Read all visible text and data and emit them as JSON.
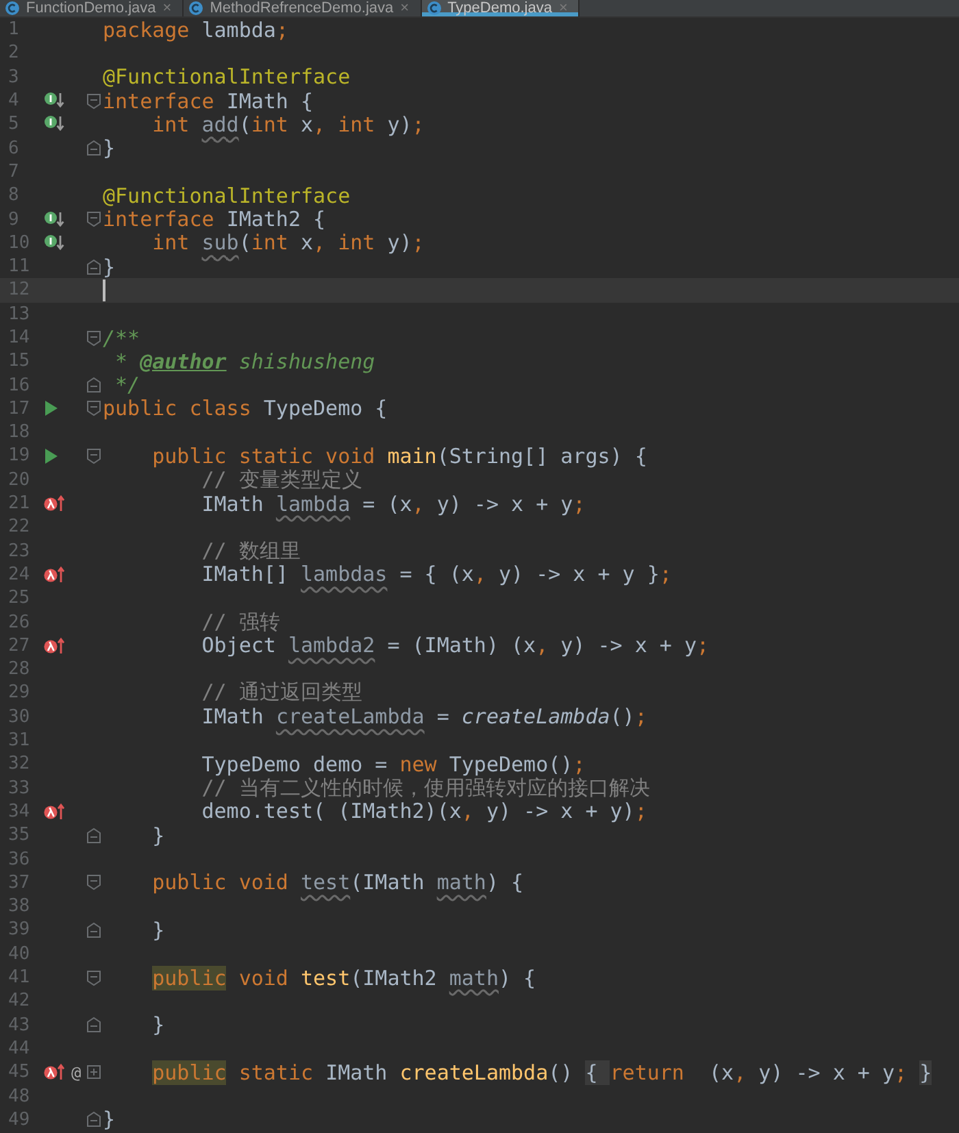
{
  "tabs": [
    {
      "label": "FunctionDemo.java",
      "close": "×",
      "selected": false
    },
    {
      "label": "MethodRefrenceDemo.java",
      "close": "×",
      "selected": false
    },
    {
      "label": "TypeDemo.java",
      "close": "×",
      "selected": true
    }
  ],
  "lines": [
    {
      "n": "1",
      "current": false,
      "tokens": [
        {
          "t": "package",
          "kind": "kw"
        },
        {
          "t": " lambda",
          "kind": "id"
        },
        {
          "t": ";",
          "kind": "kw"
        }
      ]
    },
    {
      "n": "2",
      "current": false
    },
    {
      "n": "3",
      "current": false,
      "tokens": [
        {
          "t": "@FunctionalInterface",
          "kind": "ann"
        }
      ]
    },
    {
      "n": "4",
      "current": false,
      "gutter_icon": {
        "kind": "implemented"
      },
      "fold": {
        "kind": "open"
      },
      "tokens": [
        {
          "t": "interface",
          "kind": "kw"
        },
        {
          "t": " IMath {",
          "kind": "id"
        }
      ]
    },
    {
      "n": "5",
      "current": false,
      "gutter_icon": {
        "kind": "implemented"
      },
      "tokens": [
        {
          "t": "    int ",
          "kind": "kw"
        },
        {
          "t": "add",
          "kind": "warn"
        },
        {
          "t": "(",
          "kind": "id"
        },
        {
          "t": "int",
          "kind": "kw"
        },
        {
          "t": " x",
          "kind": "id"
        },
        {
          "t": ", int",
          "kind": "kw"
        },
        {
          "t": " y)",
          "kind": "id"
        },
        {
          "t": ";",
          "kind": "kw"
        }
      ]
    },
    {
      "n": "6",
      "current": false,
      "fold": {
        "kind": "close"
      },
      "tokens": [
        {
          "t": "}",
          "kind": "id"
        }
      ]
    },
    {
      "n": "7",
      "current": false
    },
    {
      "n": "8",
      "current": false,
      "tokens": [
        {
          "t": "@FunctionalInterface",
          "kind": "ann"
        }
      ]
    },
    {
      "n": "9",
      "current": false,
      "gutter_icon": {
        "kind": "implemented"
      },
      "fold": {
        "kind": "open"
      },
      "tokens": [
        {
          "t": "interface",
          "kind": "kw"
        },
        {
          "t": " IMath2 {",
          "kind": "id"
        }
      ]
    },
    {
      "n": "10",
      "current": false,
      "gutter_icon": {
        "kind": "implemented"
      },
      "tokens": [
        {
          "t": "    int ",
          "kind": "kw"
        },
        {
          "t": "sub",
          "kind": "warn"
        },
        {
          "t": "(",
          "kind": "id"
        },
        {
          "t": "int",
          "kind": "kw"
        },
        {
          "t": " x",
          "kind": "id"
        },
        {
          "t": ", int",
          "kind": "kw"
        },
        {
          "t": " y)",
          "kind": "id"
        },
        {
          "t": ";",
          "kind": "kw"
        }
      ]
    },
    {
      "n": "11",
      "current": false,
      "fold": {
        "kind": "close"
      },
      "tokens": [
        {
          "t": "}",
          "kind": "id"
        }
      ]
    },
    {
      "n": "12",
      "current": true
    },
    {
      "n": "13",
      "current": false
    },
    {
      "n": "14",
      "current": false,
      "fold": {
        "kind": "open"
      },
      "tokens": [
        {
          "t": "/**",
          "kind": "doc"
        }
      ]
    },
    {
      "n": "15",
      "current": false,
      "tokens": [
        {
          "t": " * ",
          "kind": "doc"
        },
        {
          "t": "@author",
          "kind": "tag"
        },
        {
          "t": " shishusheng",
          "kind": "doc"
        }
      ]
    },
    {
      "n": "16",
      "current": false,
      "fold": {
        "kind": "close"
      },
      "tokens": [
        {
          "t": " */",
          "kind": "doc"
        }
      ]
    },
    {
      "n": "17",
      "current": false,
      "gutter_icon": {
        "kind": "run"
      },
      "fold": {
        "kind": "open"
      },
      "tokens": [
        {
          "t": "public class",
          "kind": "kw"
        },
        {
          "t": " TypeDemo {",
          "kind": "id"
        }
      ]
    },
    {
      "n": "18",
      "current": false
    },
    {
      "n": "19",
      "current": false,
      "gutter_icon": {
        "kind": "run"
      },
      "fold": {
        "kind": "open"
      },
      "tokens": [
        {
          "t": "    public static void ",
          "kind": "kw"
        },
        {
          "t": "main",
          "kind": "fn"
        },
        {
          "t": "(String[] args) {",
          "kind": "id"
        }
      ]
    },
    {
      "n": "20",
      "current": false,
      "tokens": [
        {
          "t": "        // 变量类型定义",
          "kind": "cmt"
        }
      ]
    },
    {
      "n": "21",
      "current": false,
      "gutter_icon": {
        "kind": "lambda"
      },
      "tokens": [
        {
          "t": "        IMath ",
          "kind": "id"
        },
        {
          "t": "lambda",
          "kind": "warn"
        },
        {
          "t": " = (x",
          "kind": "id"
        },
        {
          "t": ",",
          "kind": "kw"
        },
        {
          "t": " y) -> x + y",
          "kind": "id"
        },
        {
          "t": ";",
          "kind": "kw"
        }
      ]
    },
    {
      "n": "22",
      "current": false
    },
    {
      "n": "23",
      "current": false,
      "tokens": [
        {
          "t": "        // 数组里",
          "kind": "cmt"
        }
      ]
    },
    {
      "n": "24",
      "current": false,
      "gutter_icon": {
        "kind": "lambda"
      },
      "tokens": [
        {
          "t": "        IMath[] ",
          "kind": "id"
        },
        {
          "t": "lambdas",
          "kind": "warn"
        },
        {
          "t": " = { (x",
          "kind": "id"
        },
        {
          "t": ",",
          "kind": "kw"
        },
        {
          "t": " y) -> x + y }",
          "kind": "id"
        },
        {
          "t": ";",
          "kind": "kw"
        }
      ]
    },
    {
      "n": "25",
      "current": false
    },
    {
      "n": "26",
      "current": false,
      "tokens": [
        {
          "t": "        // 强转",
          "kind": "cmt"
        }
      ]
    },
    {
      "n": "27",
      "current": false,
      "gutter_icon": {
        "kind": "lambda"
      },
      "tokens": [
        {
          "t": "        Object ",
          "kind": "id"
        },
        {
          "t": "lambda2",
          "kind": "warn"
        },
        {
          "t": " = (IMath) (x",
          "kind": "id"
        },
        {
          "t": ",",
          "kind": "kw"
        },
        {
          "t": " y) -> x + y",
          "kind": "id"
        },
        {
          "t": ";",
          "kind": "kw"
        }
      ]
    },
    {
      "n": "28",
      "current": false
    },
    {
      "n": "29",
      "current": false,
      "tokens": [
        {
          "t": "        // 通过返回类型",
          "kind": "cmt"
        }
      ]
    },
    {
      "n": "30",
      "current": false,
      "tokens": [
        {
          "t": "        IMath ",
          "kind": "id"
        },
        {
          "t": "createLambda",
          "kind": "warn"
        },
        {
          "t": " = ",
          "kind": "id"
        },
        {
          "t": "createLambda",
          "kind": "ifn"
        },
        {
          "t": "()",
          "kind": "id"
        },
        {
          "t": ";",
          "kind": "kw"
        }
      ]
    },
    {
      "n": "31",
      "current": false
    },
    {
      "n": "32",
      "current": false,
      "tokens": [
        {
          "t": "        TypeDemo demo = ",
          "kind": "id"
        },
        {
          "t": "new",
          "kind": "kw"
        },
        {
          "t": " TypeDemo()",
          "kind": "id"
        },
        {
          "t": ";",
          "kind": "kw"
        }
      ]
    },
    {
      "n": "33",
      "current": false,
      "tokens": [
        {
          "t": "        // 当有二义性的时候，使用强转对应的接口解决",
          "kind": "cmt"
        }
      ]
    },
    {
      "n": "34",
      "current": false,
      "gutter_icon": {
        "kind": "lambda"
      },
      "tokens": [
        {
          "t": "        demo.test( (IMath2)(x",
          "kind": "id"
        },
        {
          "t": ",",
          "kind": "kw"
        },
        {
          "t": " y) -> x + y)",
          "kind": "id"
        },
        {
          "t": ";",
          "kind": "kw"
        }
      ]
    },
    {
      "n": "35",
      "current": false,
      "fold": {
        "kind": "close"
      },
      "tokens": [
        {
          "t": "    }",
          "kind": "id"
        }
      ]
    },
    {
      "n": "36",
      "current": false
    },
    {
      "n": "37",
      "current": false,
      "fold": {
        "kind": "open"
      },
      "tokens": [
        {
          "t": "    public void ",
          "kind": "kw"
        },
        {
          "t": "test",
          "kind": "warn"
        },
        {
          "t": "(IMath ",
          "kind": "id"
        },
        {
          "t": "math",
          "kind": "warn"
        },
        {
          "t": ") {",
          "kind": "id"
        }
      ]
    },
    {
      "n": "38",
      "current": false
    },
    {
      "n": "39",
      "current": false,
      "fold": {
        "kind": "close"
      },
      "tokens": [
        {
          "t": "    }",
          "kind": "id"
        }
      ]
    },
    {
      "n": "40",
      "current": false
    },
    {
      "n": "41",
      "current": false,
      "fold": {
        "kind": "open"
      },
      "tokens": [
        {
          "t": "    public",
          "kind": "kwhl"
        },
        {
          "t": " void ",
          "kind": "kw"
        },
        {
          "t": "test",
          "kind": "fn"
        },
        {
          "t": "(IMath2 ",
          "kind": "id"
        },
        {
          "t": "math",
          "kind": "warn"
        },
        {
          "t": ") {",
          "kind": "id"
        }
      ]
    },
    {
      "n": "42",
      "current": false
    },
    {
      "n": "43",
      "current": false,
      "fold": {
        "kind": "close"
      },
      "tokens": [
        {
          "t": "    }",
          "kind": "id"
        }
      ]
    },
    {
      "n": "44",
      "current": false
    },
    {
      "n": "45",
      "current": false,
      "gutter_icon": {
        "kind": "lambda"
      },
      "badge": "@",
      "fold": {
        "kind": "collapsed"
      },
      "tokens": [
        {
          "t": "    public",
          "kind": "kwhl"
        },
        {
          "t": " static",
          "kind": "kw"
        },
        {
          "t": " IMath ",
          "kind": "id"
        },
        {
          "t": "createLambda",
          "kind": "fn"
        },
        {
          "t": "()",
          "kind": "id"
        },
        {
          "t": " { ",
          "kind": "fold"
        },
        {
          "t": "return",
          "kind": "kw"
        },
        {
          "t": "  (x",
          "kind": "id"
        },
        {
          "t": ",",
          "kind": "kw"
        },
        {
          "t": " y) -> x + y",
          "kind": "id"
        },
        {
          "t": ";",
          "kind": "kw"
        },
        {
          "t": " }",
          "kind": "fold"
        }
      ]
    },
    {
      "n": "48",
      "current": false
    },
    {
      "n": "49",
      "current": false,
      "fold": {
        "kind": "close"
      },
      "tokens": [
        {
          "t": "}",
          "kind": "id"
        }
      ]
    }
  ]
}
